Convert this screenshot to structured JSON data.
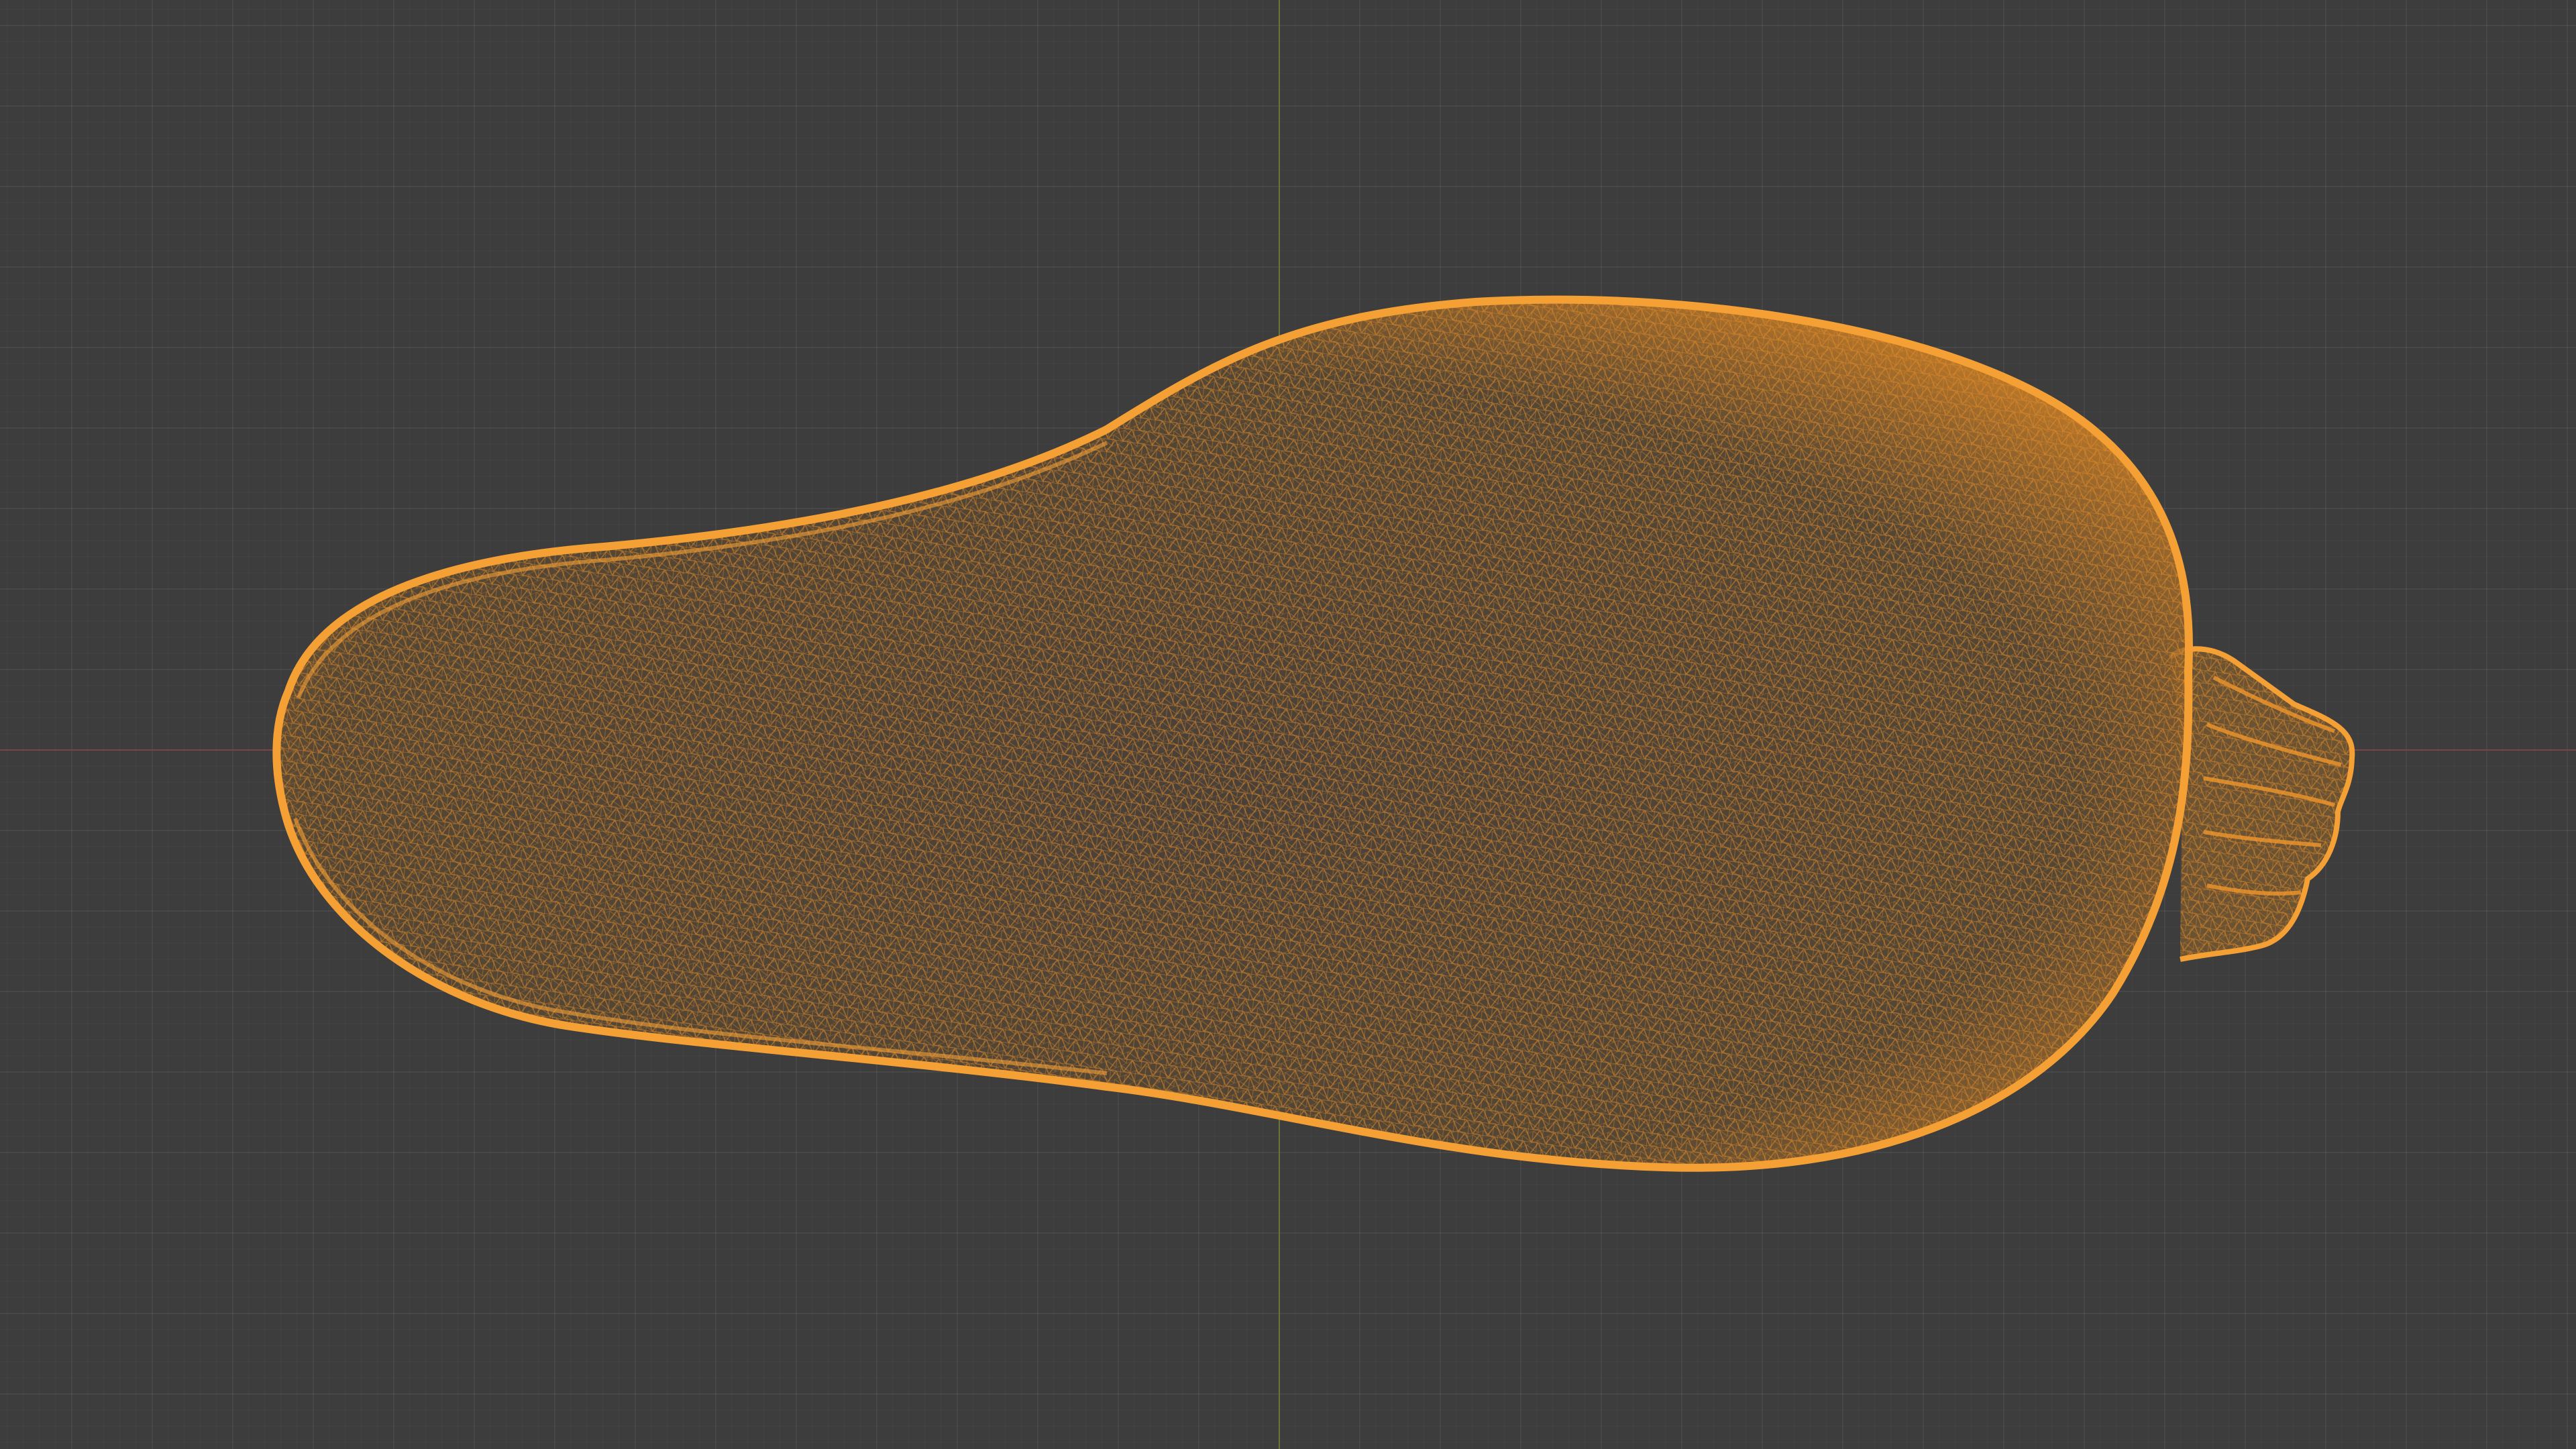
{
  "viewport": {
    "name": "3D Viewport",
    "mode": "wireframe",
    "background_color": "#3d3d3d",
    "grid_color": "#4a4a4a",
    "x_axis_color": "#7a4545",
    "y_axis_color": "#6b7338"
  },
  "object": {
    "name": "squash-mesh",
    "display": "wireframe",
    "selected": true,
    "wire_color": "#f0962a",
    "fill_color": "#6a5232"
  }
}
